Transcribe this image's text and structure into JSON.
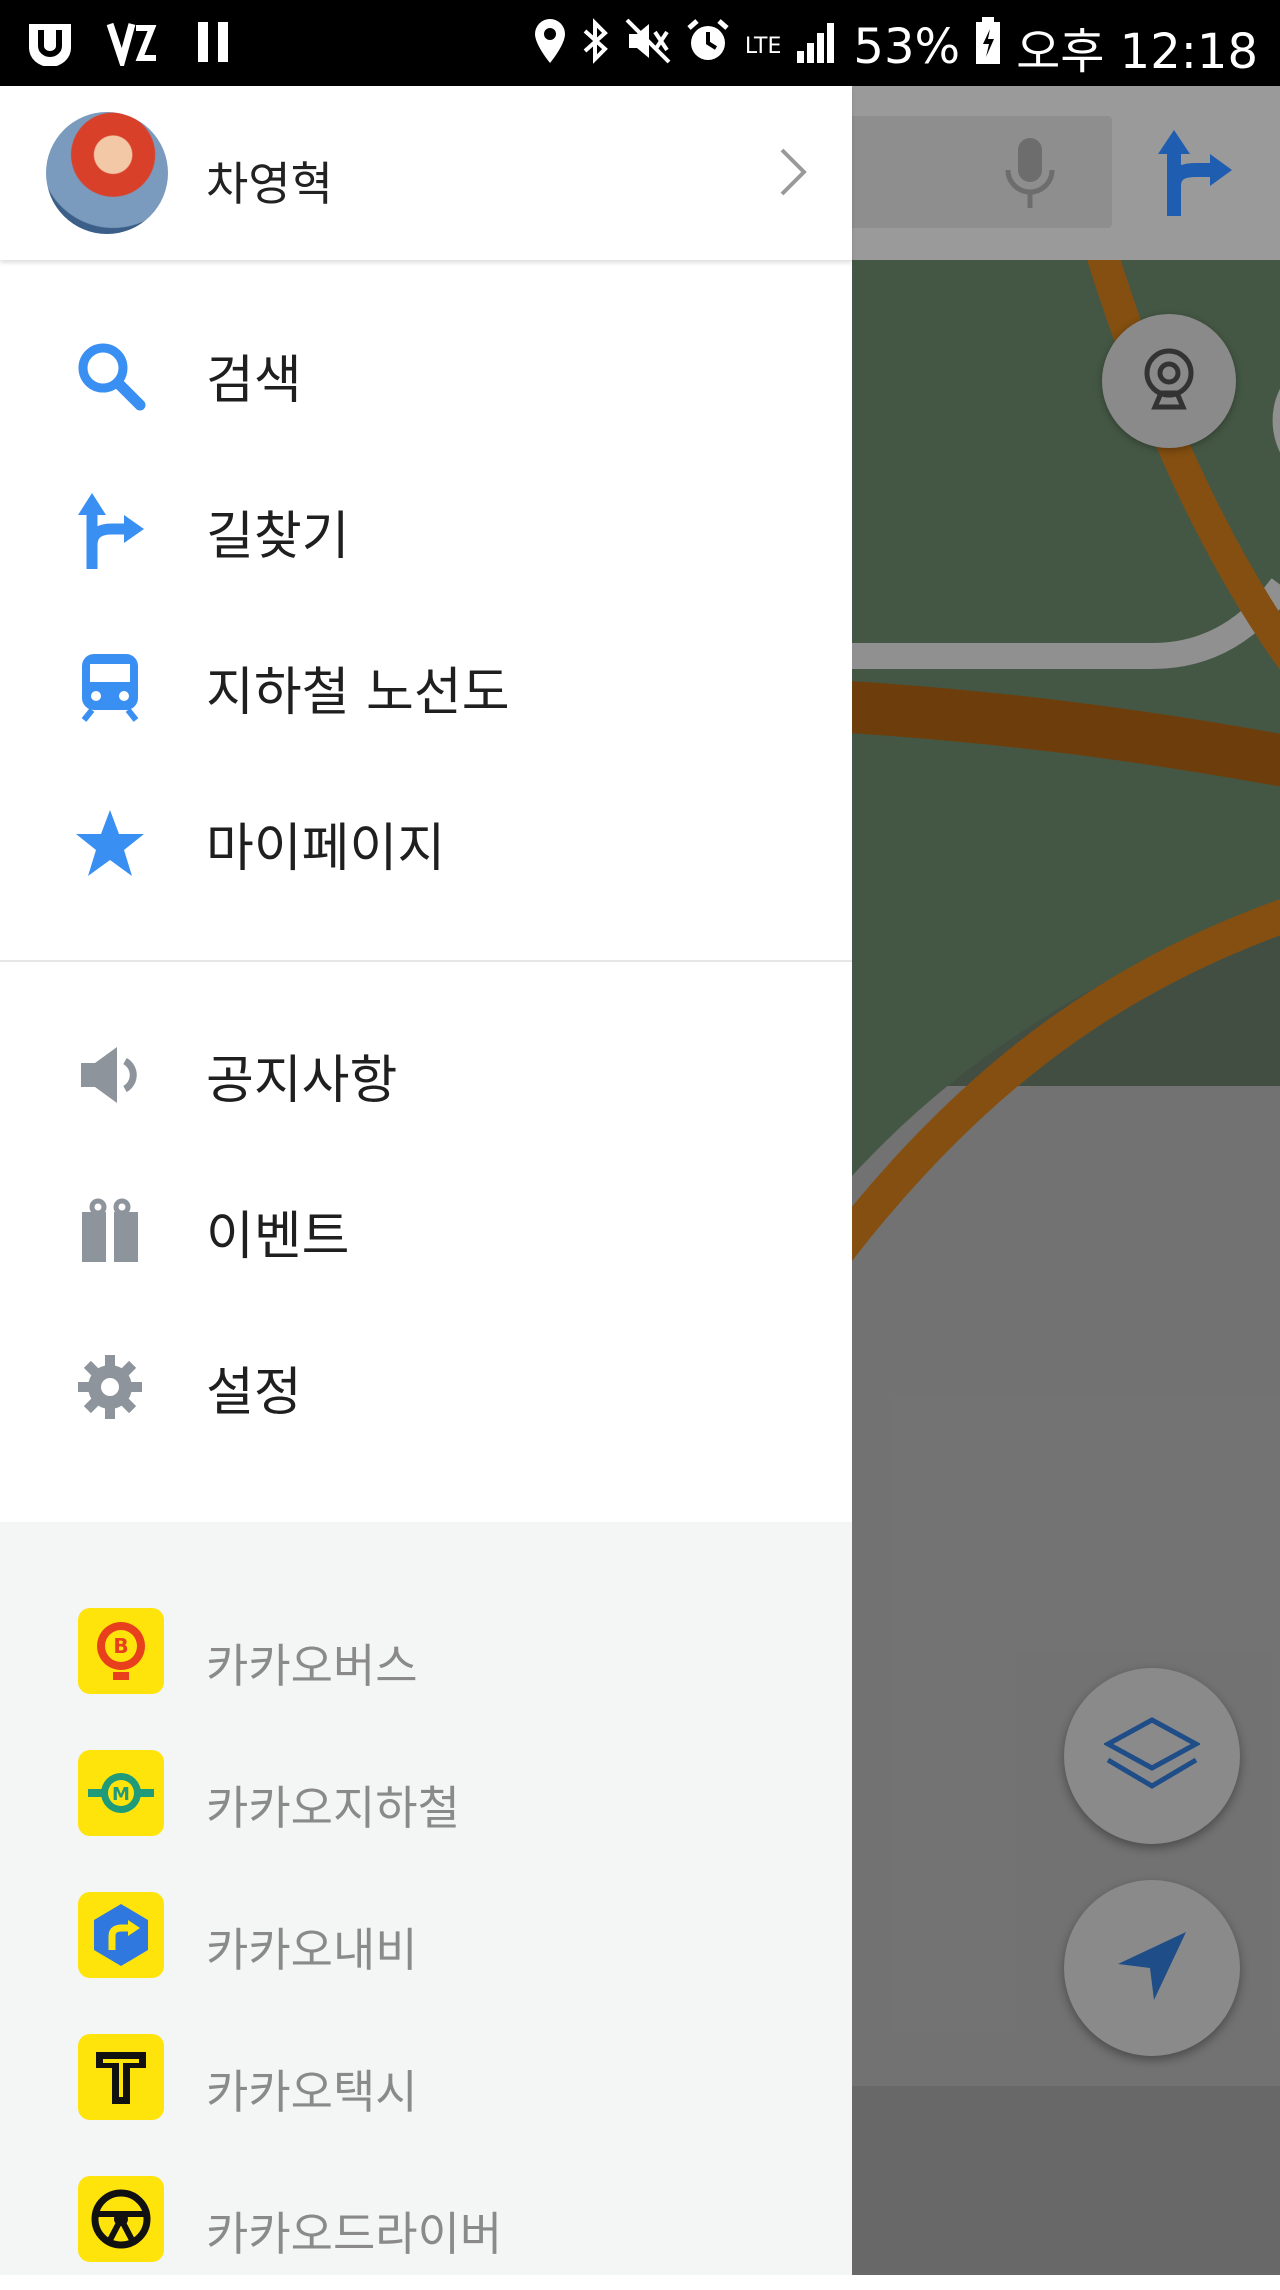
{
  "status_bar": {
    "battery": "53%",
    "time": "오후 12:18",
    "network": "LTE"
  },
  "profile": {
    "name": "차영혁"
  },
  "menu_primary": [
    {
      "label": "검색",
      "icon": "search-icon"
    },
    {
      "label": "길찾기",
      "icon": "directions-icon"
    },
    {
      "label": "지하철 노선도",
      "icon": "subway-icon"
    },
    {
      "label": "마이페이지",
      "icon": "star-icon"
    }
  ],
  "menu_secondary": [
    {
      "label": "공지사항",
      "icon": "speaker-icon"
    },
    {
      "label": "이벤트",
      "icon": "gift-icon"
    },
    {
      "label": "설정",
      "icon": "gear-icon"
    }
  ],
  "apps": [
    {
      "label": "카카오버스",
      "icon": "kakao-bus-icon"
    },
    {
      "label": "카카오지하철",
      "icon": "kakao-metro-icon"
    },
    {
      "label": "카카오내비",
      "icon": "kakao-navi-icon"
    },
    {
      "label": "카카오택시",
      "icon": "kakao-taxi-icon"
    },
    {
      "label": "카카오드라이버",
      "icon": "kakao-driver-icon"
    }
  ],
  "colors": {
    "accent_blue": "#3a8ff2",
    "icon_gray": "#8e949c",
    "kakao_yellow": "#ffe40c"
  }
}
